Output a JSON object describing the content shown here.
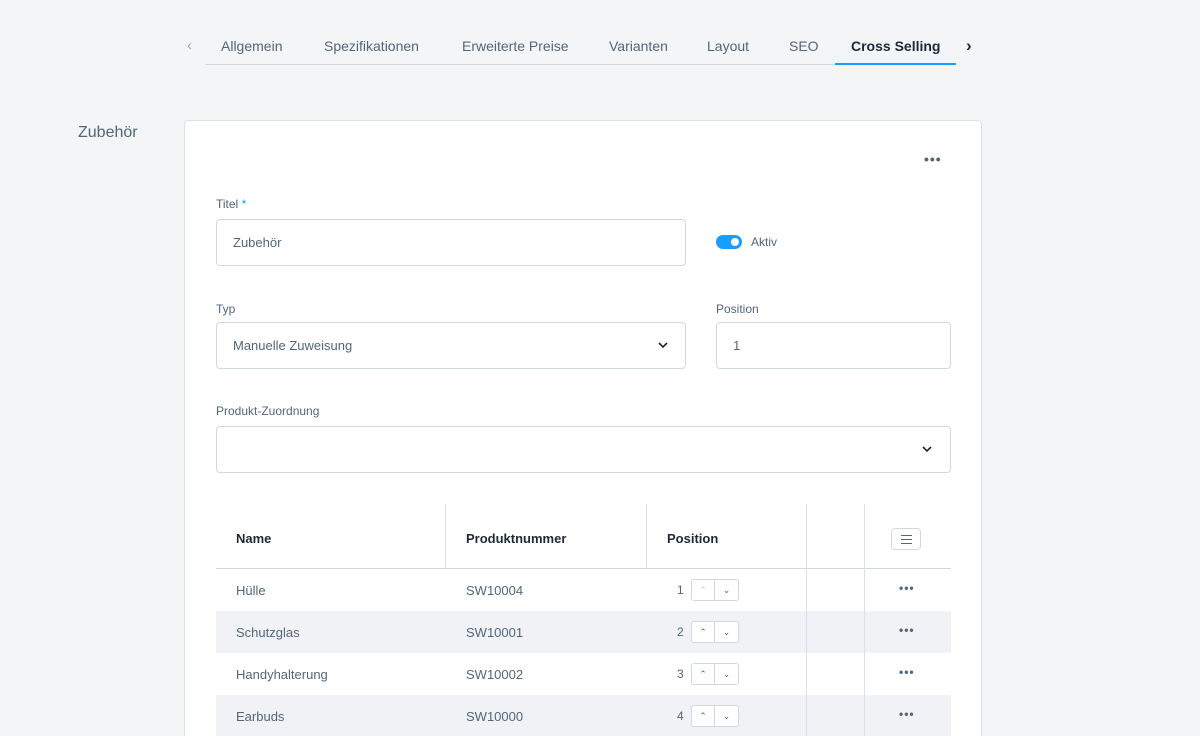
{
  "tabs": {
    "items": [
      {
        "label": "Allgemein"
      },
      {
        "label": "Spezifikationen"
      },
      {
        "label": "Erweiterte Preise"
      },
      {
        "label": "Varianten"
      },
      {
        "label": "Layout"
      },
      {
        "label": "SEO"
      },
      {
        "label": "Cross Selling",
        "active": true
      }
    ],
    "prev_icon": "chevron-left-icon",
    "next_icon": "chevron-right-icon"
  },
  "section": {
    "label": "Zubehör"
  },
  "card": {
    "menu_label": "•••",
    "title": {
      "label": "Titel",
      "required_mark": "*",
      "value": "Zubehör"
    },
    "active": {
      "label": "Aktiv",
      "value": true
    },
    "type": {
      "label": "Typ",
      "value": "Manuelle Zuweisung"
    },
    "position": {
      "label": "Position",
      "value": "1"
    },
    "product_assignment": {
      "label": "Produkt-Zuordnung",
      "value": ""
    }
  },
  "grid": {
    "columns": {
      "name": "Name",
      "product_number": "Produktnummer",
      "position": "Position"
    },
    "rows": [
      {
        "name": "Hülle",
        "number": "SW10004",
        "position": "1",
        "menu": "•••"
      },
      {
        "name": "Schutzglas",
        "number": "SW10001",
        "position": "2",
        "menu": "•••"
      },
      {
        "name": "Handyhalterung",
        "number": "SW10002",
        "position": "3",
        "menu": "•••"
      },
      {
        "name": "Earbuds",
        "number": "SW10000",
        "position": "4",
        "menu": "•••"
      }
    ]
  },
  "colors": {
    "accent": "#189eff",
    "text": "#52667a",
    "heading": "#1b2a3a"
  }
}
